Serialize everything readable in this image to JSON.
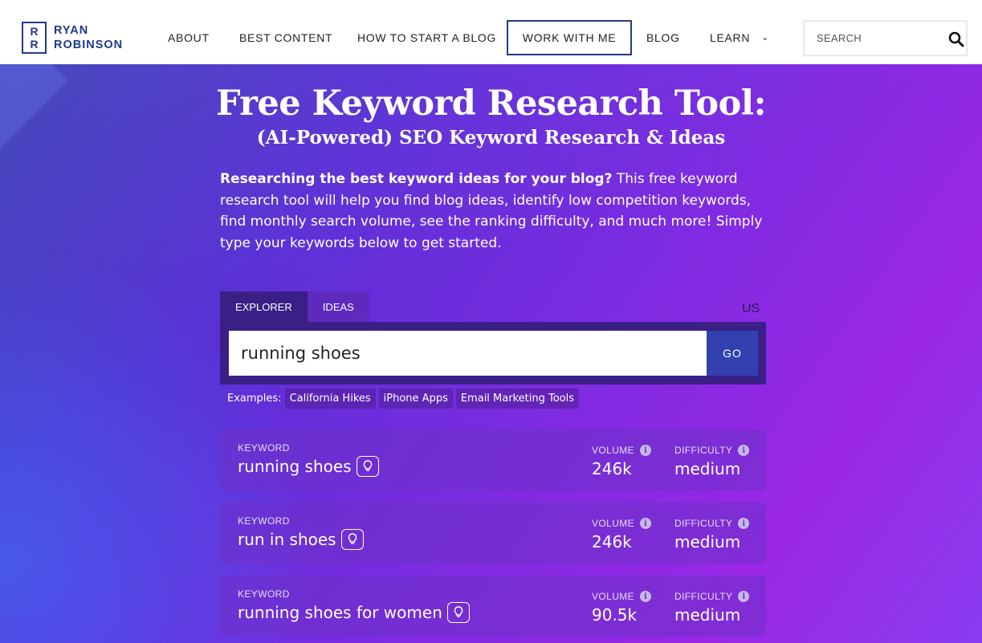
{
  "brand": {
    "line1": "RYAN",
    "line2": "ROBINSON",
    "mark_top": "R",
    "mark_bottom": "R"
  },
  "nav": {
    "items": [
      "ABOUT",
      "BEST CONTENT",
      "HOW TO START A BLOG",
      "WORK WITH ME",
      "BLOG",
      "LEARN"
    ],
    "search_placeholder": "SEARCH"
  },
  "hero": {
    "title": "Free Keyword Research Tool:",
    "subtitle": "(AI-Powered) SEO Keyword Research & Ideas",
    "intro_bold": "Researching the best keyword ideas for your blog?",
    "intro_rest": " This free keyword research tool will help you find blog ideas, identify low competition keywords, find monthly search volume, see the ranking difficulty, and much more! Simply type your keywords below to get started."
  },
  "tool": {
    "tabs": [
      "EXPLORER",
      "IDEAS"
    ],
    "active_tab": "EXPLORER",
    "country": "US",
    "query": "running shoes",
    "go_label": "GO",
    "examples_label": "Examples:",
    "examples": [
      "California Hikes",
      "iPhone Apps",
      "Email Marketing Tools"
    ]
  },
  "results": {
    "keyword_label": "KEYWORD",
    "volume_label": "VOLUME",
    "difficulty_label": "DIFFICULTY",
    "rows": [
      {
        "keyword": "running shoes",
        "volume": "246k",
        "difficulty": "medium"
      },
      {
        "keyword": "run in shoes",
        "volume": "246k",
        "difficulty": "medium"
      },
      {
        "keyword": "running shoes for women",
        "volume": "90.5k",
        "difficulty": "medium"
      }
    ]
  },
  "colors": {
    "brand_blue": "#1f3a8a",
    "panel_purple": "#3a1f86",
    "go_blue": "#3240b0"
  },
  "icons": [
    "search-icon",
    "chevron-down-icon",
    "lightbulb-icon",
    "info-icon"
  ]
}
